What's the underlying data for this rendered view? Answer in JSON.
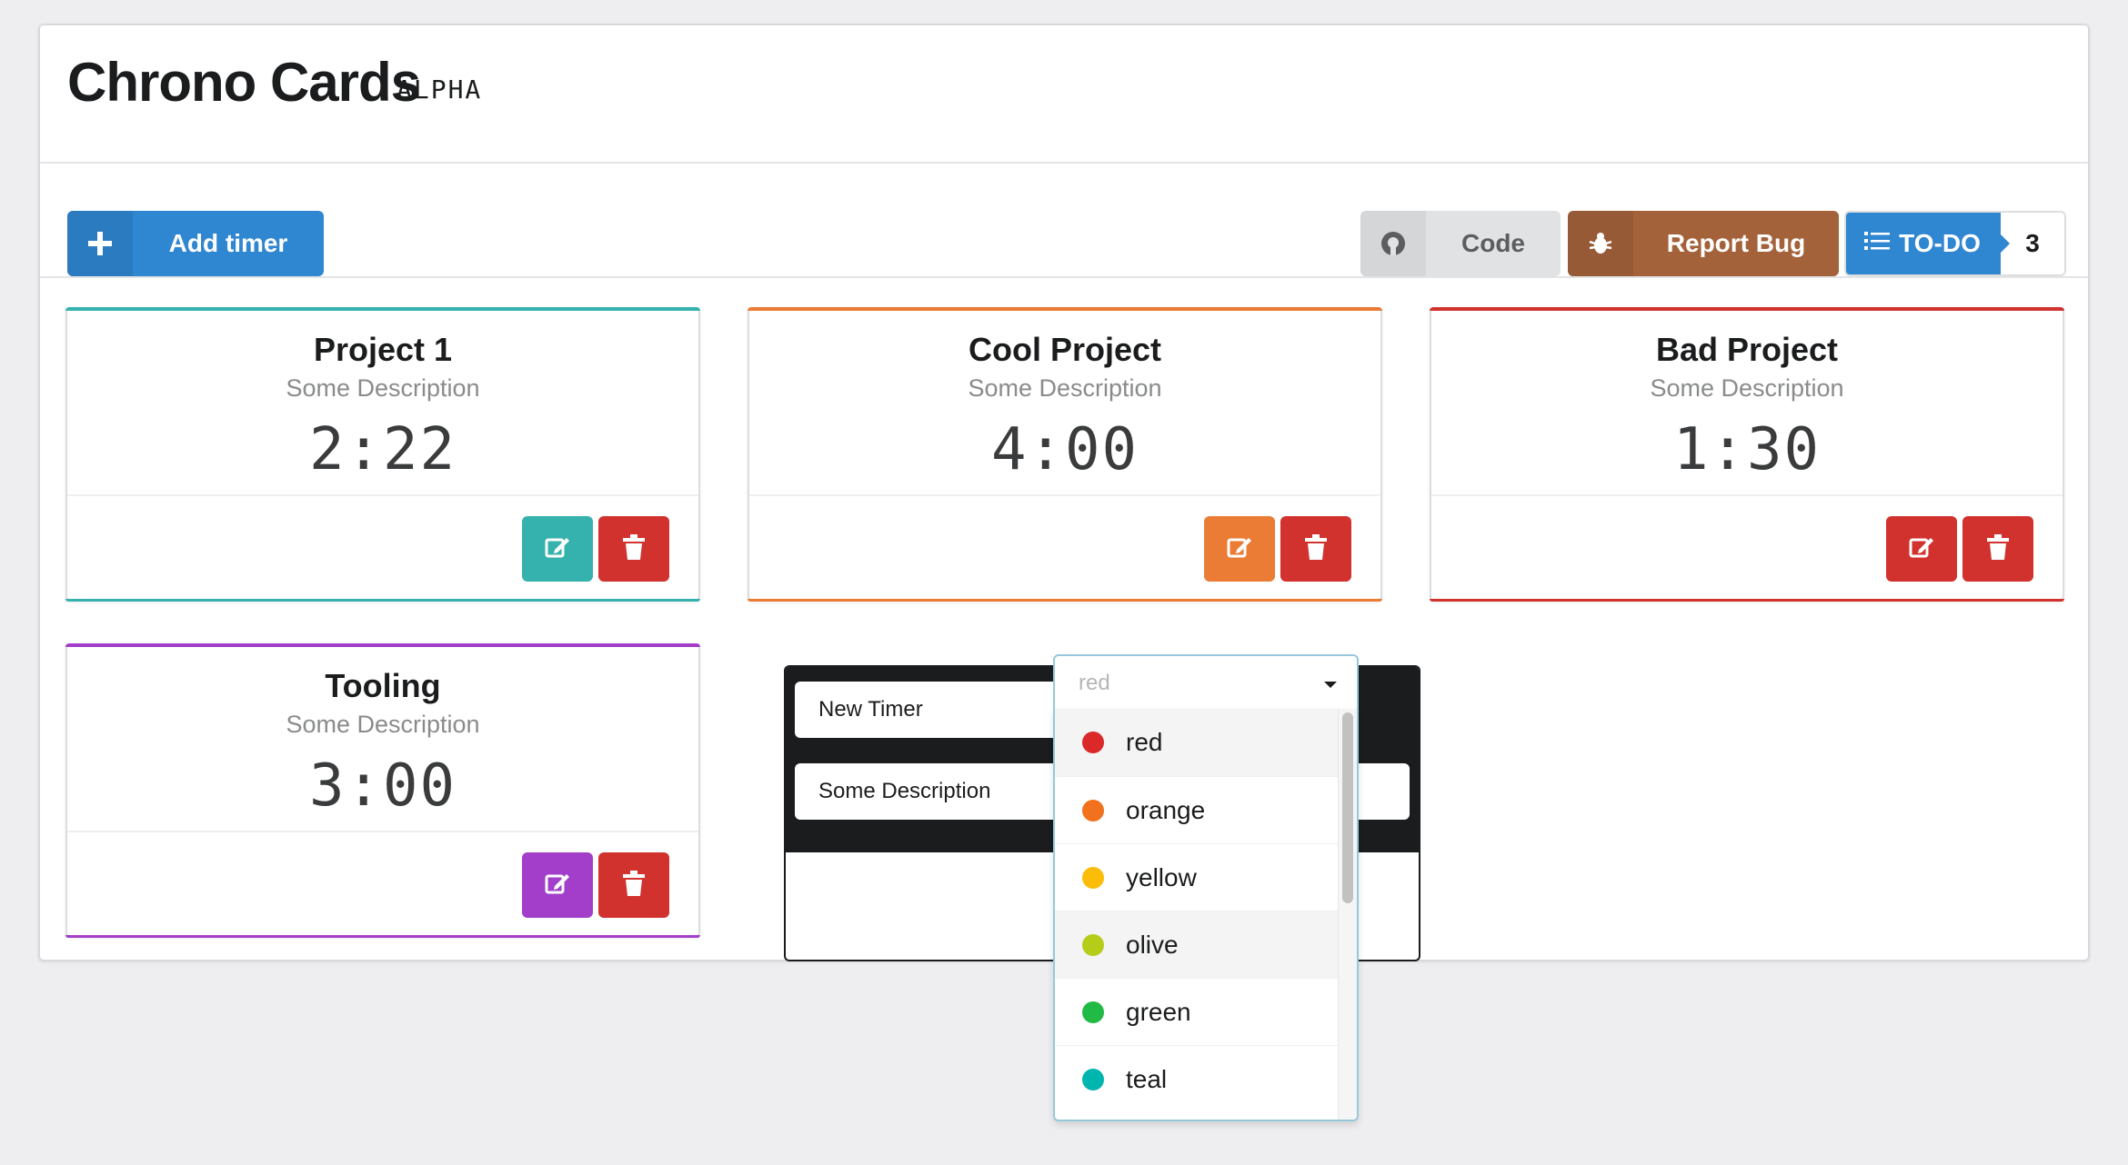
{
  "app": {
    "title": "Chrono Cards",
    "badge": "ALPHA"
  },
  "toolbar": {
    "add_label": "Add timer",
    "code_label": "Code",
    "bug_label": "Report Bug",
    "todo_label": "TO-DO",
    "todo_count": "3"
  },
  "cards": [
    {
      "name": "Project 1",
      "desc": "Some Description",
      "time": "2:22",
      "color": "#35b2ad"
    },
    {
      "name": "Cool Project",
      "desc": "Some Description",
      "time": "4:00",
      "color": "#ea7c35"
    },
    {
      "name": "Bad Project",
      "desc": "Some Description",
      "time": "1:30",
      "color": "#d1322d"
    },
    {
      "name": "Tooling",
      "desc": "Some Description",
      "time": "3:00",
      "color": "#a23ec9"
    }
  ],
  "editor": {
    "name_value": "New Timer",
    "desc_value": "Some Description",
    "color_placeholder": "red"
  },
  "color_options": [
    {
      "label": "red",
      "color": "#db2828"
    },
    {
      "label": "orange",
      "color": "#f2711c"
    },
    {
      "label": "yellow",
      "color": "#fbbd08"
    },
    {
      "label": "olive",
      "color": "#b5cc18"
    },
    {
      "label": "green",
      "color": "#21ba45"
    },
    {
      "label": "teal",
      "color": "#00b5ad"
    }
  ]
}
